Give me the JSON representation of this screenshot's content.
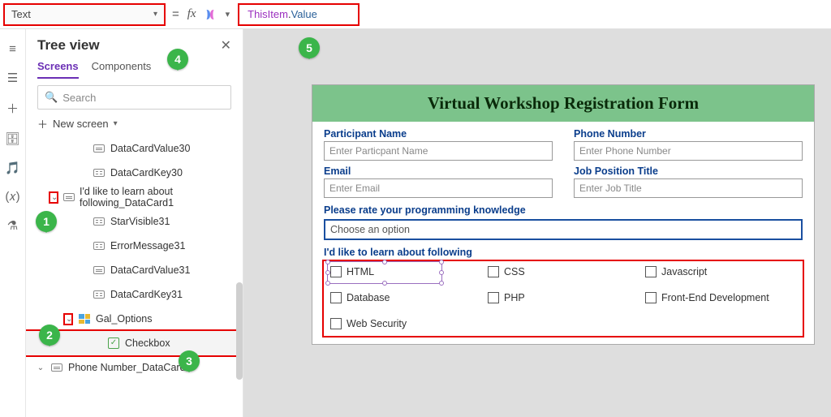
{
  "formula_bar": {
    "property": "Text",
    "equals": "=",
    "fx": "fx",
    "formula_tokens": {
      "item": "ThisItem",
      "dot": ".",
      "field": "Value"
    }
  },
  "panel": {
    "title": "Tree view",
    "tabs": {
      "screens": "Screens",
      "components": "Components"
    },
    "search_placeholder": "Search",
    "new_screen": "New screen",
    "nodes": {
      "n0": "DataCardValue30",
      "n1": "DataCardKey30",
      "n2": "I'd like to learn about following_DataCard1",
      "n3": "StarVisible31",
      "n4": "ErrorMessage31",
      "n5": "DataCardValue31",
      "n6": "DataCardKey31",
      "n7": "Gal_Options",
      "n8": "Checkbox",
      "n9": "Phone Number_DataCard1"
    }
  },
  "form": {
    "title": "Virtual Workshop Registration Form",
    "participant_label": "Participant Name",
    "participant_ph": "Enter Particpant Name",
    "phone_label": "Phone Number",
    "phone_ph": "Enter Phone Number",
    "email_label": "Email",
    "email_ph": "Enter Email",
    "job_label": "Job Position Title",
    "job_ph": "Enter Job Title",
    "rate_label": "Please rate your programming knowledge",
    "rate_ph": "Choose an option",
    "learn_label": "I'd like to learn about following",
    "options": {
      "o0": "HTML",
      "o1": "CSS",
      "o2": "Javascript",
      "o3": "Database",
      "o4": "PHP",
      "o5": "Front-End Development",
      "o6": "Web Security"
    }
  },
  "callouts": {
    "c1": "1",
    "c2": "2",
    "c3": "3",
    "c4": "4",
    "c5": "5"
  }
}
